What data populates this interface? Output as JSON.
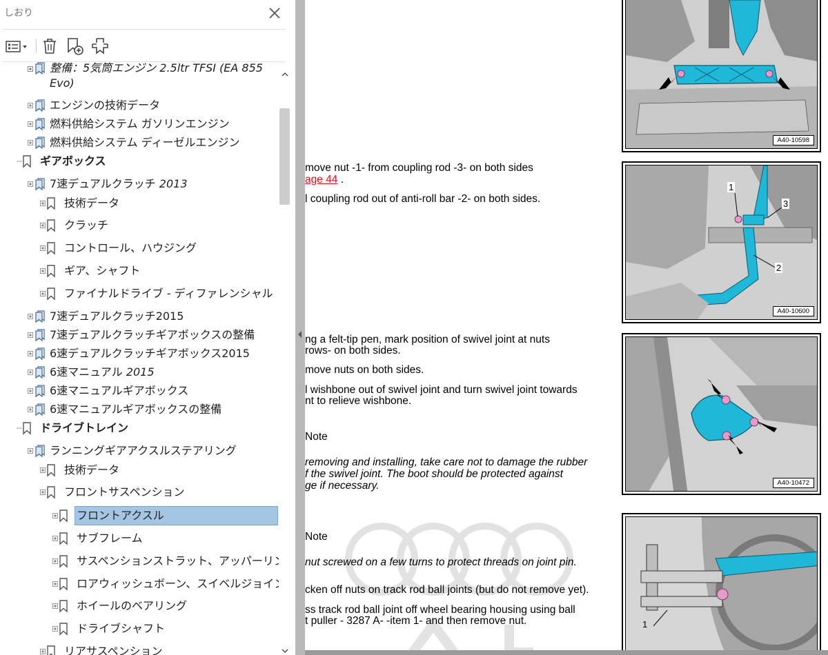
{
  "panel": {
    "title": "しおり",
    "toolbar": {
      "options": "options-menu-icon",
      "delete": "delete-bookmark-icon",
      "new": "new-bookmark-icon",
      "find": "find-current-bookmark-icon"
    },
    "tree": [
      {
        "label": "整備：5気筒エンジン 2.5ltr TFSI (EA 855",
        "continuation": "Evo)",
        "italic_part": "",
        "level": 1,
        "expandable": true,
        "bold": false
      },
      {
        "label": "エンジンの技術データ",
        "level": 1,
        "expandable": true,
        "bold": false
      },
      {
        "label": "燃料供給システム ガソリンエンジン",
        "level": 1,
        "expandable": true,
        "bold": false
      },
      {
        "label": "燃料供給システム ディーゼルエンジン",
        "level": 1,
        "expandable": true,
        "bold": false
      },
      {
        "label": "ギアボックス",
        "level": 0,
        "expandable": false,
        "bold": true
      },
      {
        "label": "7速デュアルクラッチ ",
        "italic": "2013",
        "level": 1,
        "expandable": true,
        "bold": false
      },
      {
        "label": "技術データ",
        "level": 2,
        "expandable": true,
        "bold": false
      },
      {
        "label": "クラッチ",
        "level": 2,
        "expandable": true,
        "bold": false
      },
      {
        "label": "コントロール、ハウジング",
        "level": 2,
        "expandable": true,
        "bold": false
      },
      {
        "label": "ギア、シャフト",
        "level": 2,
        "expandable": true,
        "bold": false
      },
      {
        "label": "ファイナルドライブ - ディファレンシャル",
        "level": 2,
        "expandable": true,
        "bold": false
      },
      {
        "label": "7速デュアルクラッチ2015",
        "level": 1,
        "expandable": true,
        "bold": false
      },
      {
        "label": "7速デュアルクラッチギアボックスの整備",
        "level": 1,
        "expandable": true,
        "bold": false
      },
      {
        "label": "6速デュアルクラッチギアボックス2015",
        "level": 1,
        "expandable": true,
        "bold": false
      },
      {
        "label": "6速マニュアル ",
        "italic": "2015",
        "level": 1,
        "expandable": true,
        "bold": false
      },
      {
        "label": "6速マニュアルギアボックス",
        "level": 1,
        "expandable": true,
        "bold": false
      },
      {
        "label": "6速マニュアルギアボックスの整備",
        "level": 1,
        "expandable": true,
        "bold": false
      },
      {
        "label": "ドライブトレイン",
        "level": 0,
        "expandable": false,
        "bold": true
      },
      {
        "label": "ランニングギアアクスルステアリング",
        "level": 1,
        "expandable": true,
        "bold": false
      },
      {
        "label": "技術データ",
        "level": 2,
        "expandable": true,
        "bold": false
      },
      {
        "label": "フロントサスペンション",
        "level": 2,
        "expandable": true,
        "bold": false
      },
      {
        "label": "フロントアクスル",
        "level": 3,
        "expandable": true,
        "bold": false,
        "selected": true
      },
      {
        "label": "サブフレーム",
        "level": 3,
        "expandable": true,
        "bold": false
      },
      {
        "label": "サスペンションストラット、アッパーリンク",
        "level": 3,
        "expandable": true,
        "bold": false
      },
      {
        "label": "ロアウィッシュボーン、スイベルジョイント",
        "level": 3,
        "expandable": true,
        "bold": false
      },
      {
        "label": "ホイールのベアリング",
        "level": 3,
        "expandable": true,
        "bold": false
      },
      {
        "label": "ドライブシャフト",
        "level": 3,
        "expandable": true,
        "bold": false
      },
      {
        "label": "リアサスペンション",
        "level": 2,
        "expandable": true,
        "bold": false
      }
    ]
  },
  "document": {
    "step1_line1": "move nut -1- from coupling rod -3- on both sides",
    "step1_link": "age 44",
    "step1_after": " .",
    "step2": "l coupling rod out of anti-roll bar -2- on both sides.",
    "step3_line1": "ng a felt-tip pen, mark position of swivel joint at nuts",
    "step3_line2": "rows- on both sides.",
    "step4": "move nuts on both sides.",
    "step5_line1": "l wishbone out of swivel joint and turn swivel joint towards",
    "step5_line2": "nt to relieve wishbone.",
    "note1_title": "Note",
    "note1_line1": "removing and installing, take care not to damage the rubber",
    "note1_line2": "f the swivel joint. The boot should be protected against",
    "note1_line3": "ge if necessary.",
    "note2_title": "Note",
    "note2_line1": "nut screwed on a few turns to protect threads on joint pin.",
    "step6": "cken off nuts on track rod ball joints (but do not remove yet).",
    "step7_line1": "ss track rod ball joint off wheel bearing housing using ball",
    "step7_line2": "t puller - 3287 A- -item 1- and then remove nut.",
    "figures": [
      {
        "code": "A40-10598"
      },
      {
        "code": "A40-10600",
        "callouts": [
          "1",
          "3",
          "2"
        ]
      },
      {
        "code": "A40-10472"
      },
      {
        "code": "",
        "callouts": [
          "1"
        ]
      }
    ]
  },
  "colors": {
    "selection": "#a4c6e3",
    "part_cyan": "#1fb8d8",
    "nut_pink": "#e69ac8",
    "link_red": "#e0101a"
  }
}
